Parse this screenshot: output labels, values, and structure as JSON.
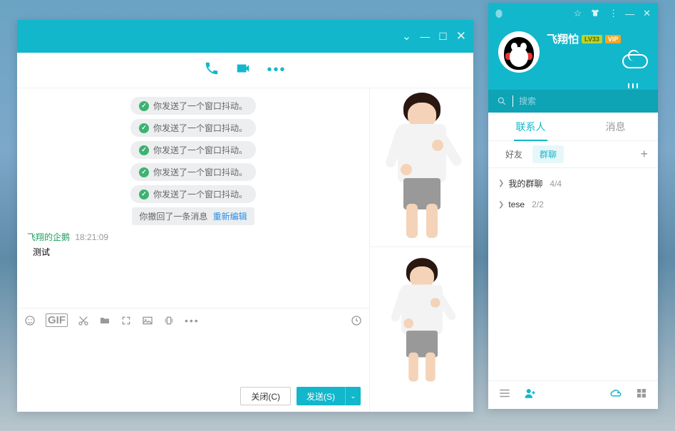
{
  "chat": {
    "title": " ",
    "toolbar_dots": "•••",
    "messages": {
      "shakes": [
        "你发送了一个窗口抖动。",
        "你发送了一个窗口抖动。",
        "你发送了一个窗口抖动。",
        "你发送了一个窗口抖动。",
        "你发送了一个窗口抖动。"
      ],
      "recall_text": "你撤回了一条消息",
      "recall_link": "重新编辑",
      "sender_name": "飞翔的企鹅",
      "sender_time": "18:21:09",
      "msg_text": "测试"
    },
    "buttons": {
      "close": "关闭(C)",
      "send": "发送(S)"
    },
    "input_toolbar": {
      "gif": "GIF",
      "more": "•••"
    }
  },
  "panel": {
    "profile": {
      "name": "飞翔怕",
      "badge_lv": "LV33",
      "badge_vip": "VIP"
    },
    "search": {
      "placeholder": "搜索"
    },
    "tabs": {
      "contacts": "联系人",
      "messages": "消息"
    },
    "subtabs": {
      "friends": "好友",
      "groups": "群聊"
    },
    "groups": [
      {
        "label": "我的群聊",
        "count": "4/4"
      },
      {
        "label": "tese",
        "count": "2/2"
      }
    ]
  }
}
